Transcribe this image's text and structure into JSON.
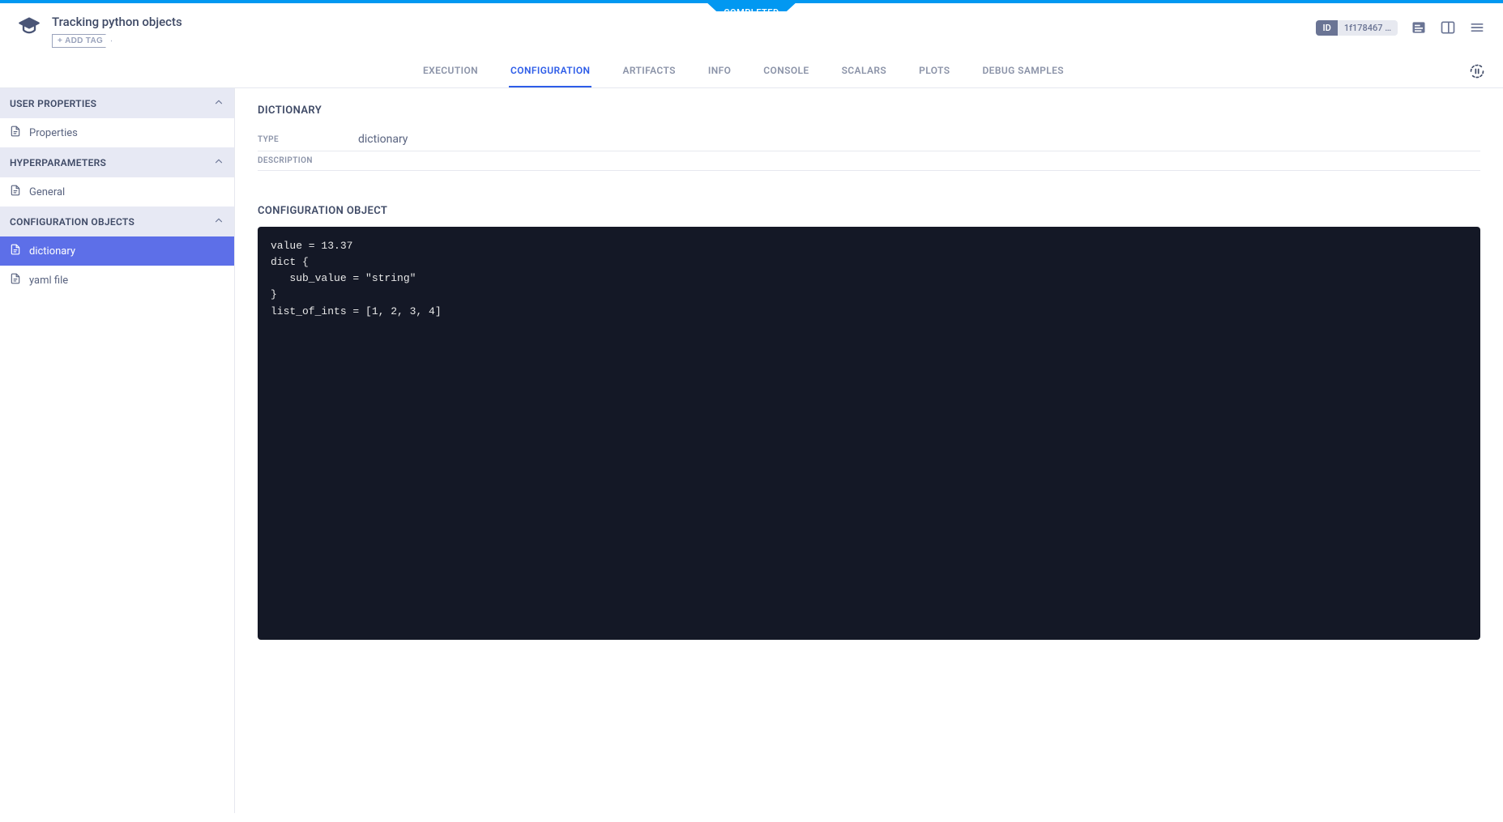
{
  "status_badge": "COMPLETED",
  "header": {
    "title": "Tracking python objects",
    "add_tag_label": "ADD TAG",
    "id_label": "ID",
    "id_value": "1f178467 …"
  },
  "tabs": [
    {
      "label": "EXECUTION",
      "active": false
    },
    {
      "label": "CONFIGURATION",
      "active": true
    },
    {
      "label": "ARTIFACTS",
      "active": false
    },
    {
      "label": "INFO",
      "active": false
    },
    {
      "label": "CONSOLE",
      "active": false
    },
    {
      "label": "SCALARS",
      "active": false
    },
    {
      "label": "PLOTS",
      "active": false
    },
    {
      "label": "DEBUG SAMPLES",
      "active": false
    }
  ],
  "sidebar": {
    "sections": [
      {
        "title": "USER PROPERTIES",
        "items": [
          {
            "label": "Properties",
            "active": false
          }
        ]
      },
      {
        "title": "HYPERPARAMETERS",
        "items": [
          {
            "label": "General",
            "active": false
          }
        ]
      },
      {
        "title": "CONFIGURATION OBJECTS",
        "items": [
          {
            "label": "dictionary",
            "active": true
          },
          {
            "label": "yaml file",
            "active": false
          }
        ]
      }
    ]
  },
  "main": {
    "dictionary_heading": "DICTIONARY",
    "type_label": "TYPE",
    "type_value": "dictionary",
    "description_label": "DESCRIPTION",
    "description_value": "",
    "config_object_heading": "CONFIGURATION OBJECT",
    "config_object_code": "value = 13.37\ndict {\n   sub_value = \"string\"\n}\nlist_of_ints = [1, 2, 3, 4]"
  }
}
